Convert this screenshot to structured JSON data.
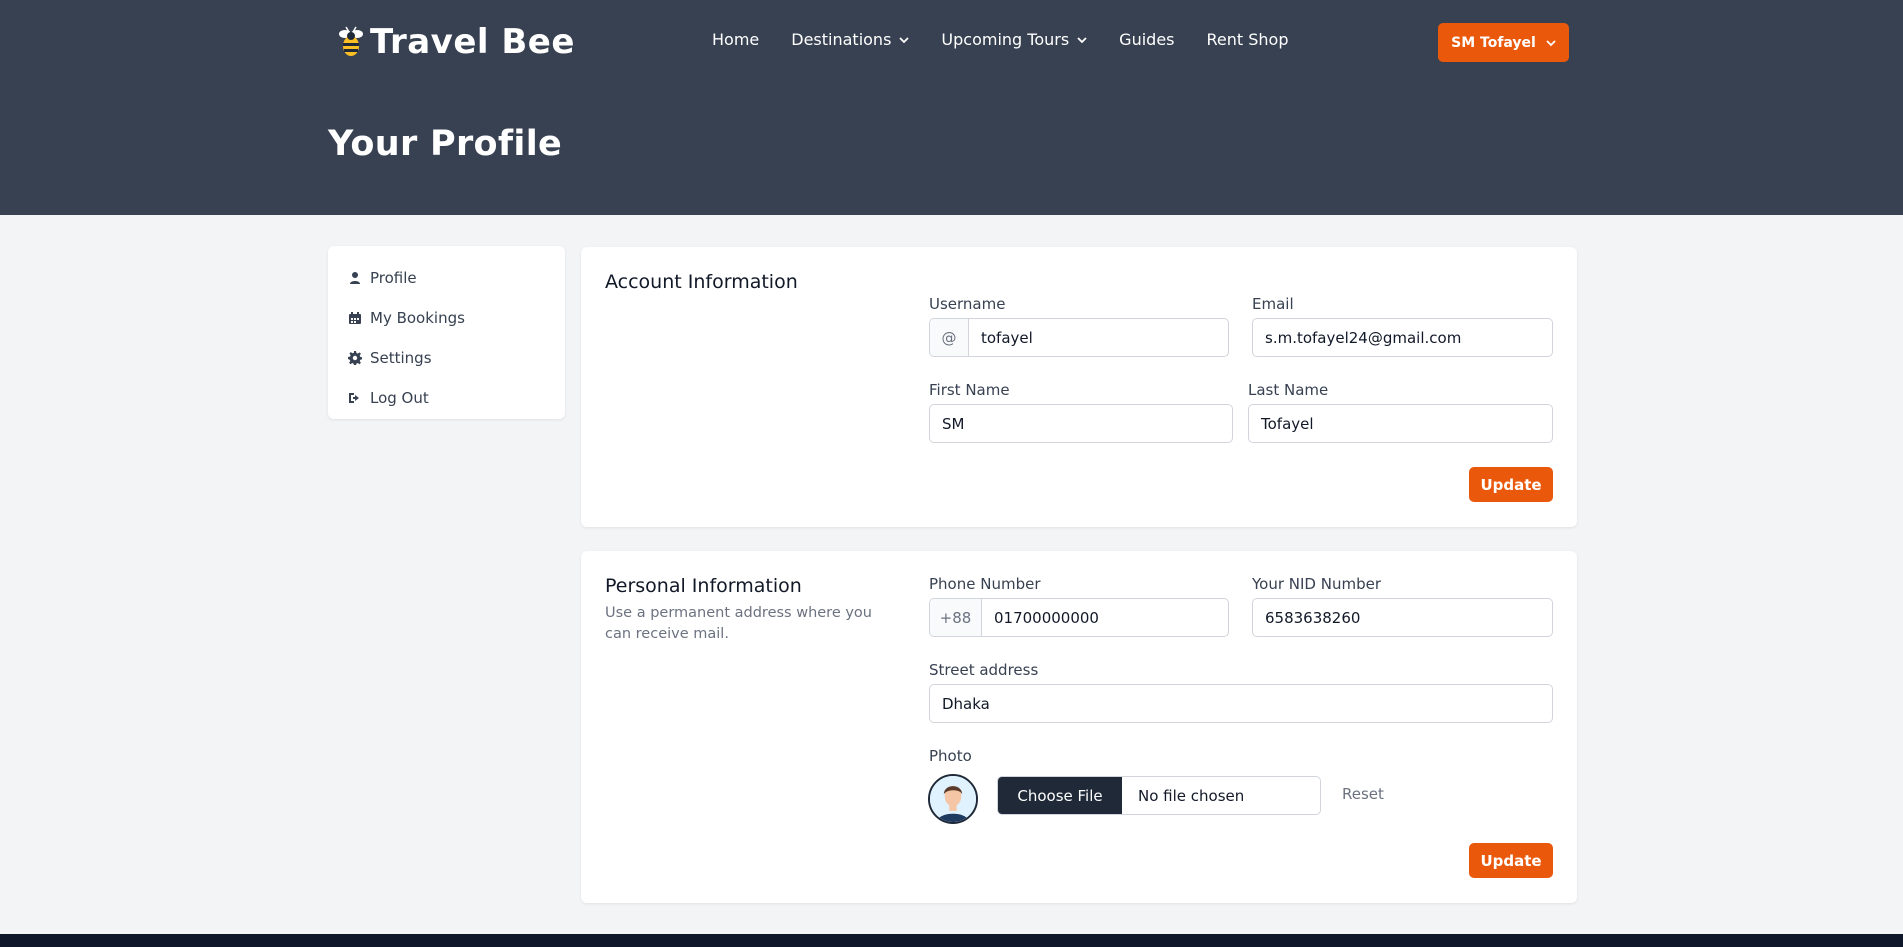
{
  "brand": {
    "name": "Travel Bee",
    "logo_icon": "bee-icon"
  },
  "nav": {
    "items": [
      {
        "label": "Home",
        "has_dropdown": false
      },
      {
        "label": "Destinations",
        "has_dropdown": true
      },
      {
        "label": "Upcoming Tours",
        "has_dropdown": true
      },
      {
        "label": "Guides",
        "has_dropdown": false
      },
      {
        "label": "Rent Shop",
        "has_dropdown": false
      }
    ],
    "user_label": "SM Tofayel"
  },
  "page": {
    "title": "Your Profile"
  },
  "sidebar": {
    "items": [
      {
        "label": "Profile",
        "icon": "user-icon"
      },
      {
        "label": "My Bookings",
        "icon": "calendar-icon"
      },
      {
        "label": "Settings",
        "icon": "gear-icon"
      },
      {
        "label": "Log Out",
        "icon": "logout-icon"
      }
    ]
  },
  "account": {
    "heading": "Account Information",
    "username_label": "Username",
    "username_prefix": "@",
    "username_value": "tofayel",
    "email_label": "Email",
    "email_value": "s.m.tofayel24@gmail.com",
    "first_name_label": "First Name",
    "first_name_value": "SM",
    "last_name_label": "Last Name",
    "last_name_value": "Tofayel",
    "update_label": "Update"
  },
  "personal": {
    "heading": "Personal Information",
    "subheading": "Use a permanent address where you can receive mail.",
    "phone_label": "Phone Number",
    "phone_prefix": "+88",
    "phone_value": "01700000000",
    "nid_label": "Your NID Number",
    "nid_value": "6583638260",
    "street_label": "Street address",
    "street_value": "Dhaka",
    "photo_label": "Photo",
    "choose_file_label": "Choose File",
    "no_file_label": "No file chosen",
    "reset_label": "Reset",
    "update_label": "Update"
  },
  "colors": {
    "header_bg": "#374151",
    "accent": "#ea580c",
    "page_bg": "#f3f4f6",
    "footer": "#0f172a"
  }
}
